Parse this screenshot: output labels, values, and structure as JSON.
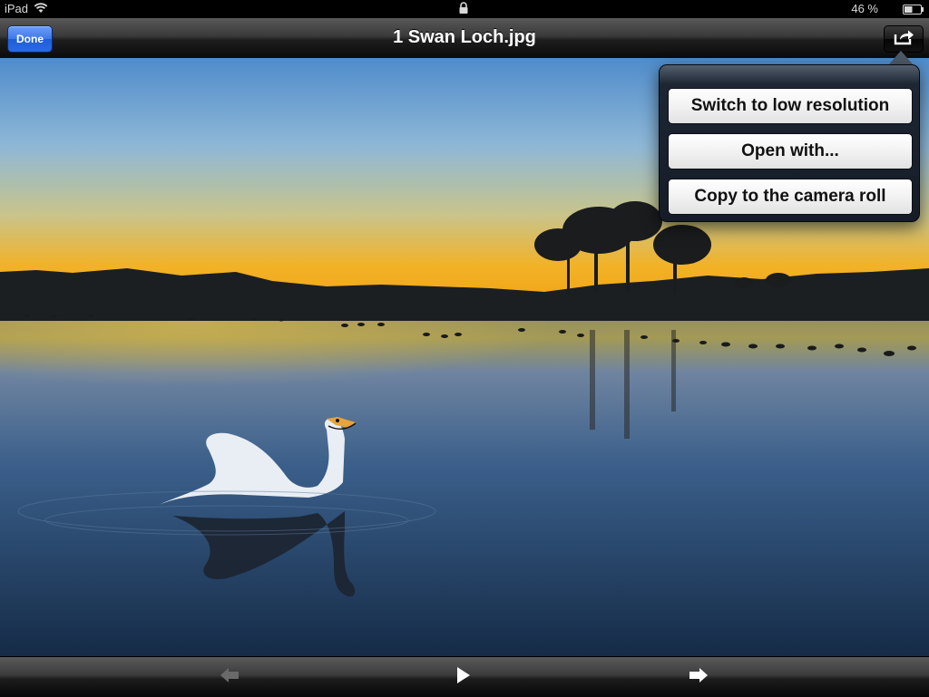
{
  "status_bar": {
    "device": "iPad",
    "battery_percent": "46 %",
    "icons": [
      "wifi-icon",
      "lock-icon",
      "battery-icon"
    ]
  },
  "nav": {
    "done_label": "Done",
    "title": "1 Swan Loch.jpg",
    "share_icon": "share-icon"
  },
  "popover": {
    "items": [
      {
        "label": "Switch to low resolution"
      },
      {
        "label": "Open with..."
      },
      {
        "label": "Copy to the camera roll"
      }
    ]
  },
  "toolbar": {
    "buttons": [
      {
        "icon": "arrow-left-icon",
        "enabled": false
      },
      {
        "icon": "play-icon",
        "enabled": true
      },
      {
        "icon": "arrow-right-icon",
        "enabled": true
      }
    ]
  },
  "colors": {
    "done_button": "#2a69e2",
    "popover_bg": "#151c27"
  }
}
